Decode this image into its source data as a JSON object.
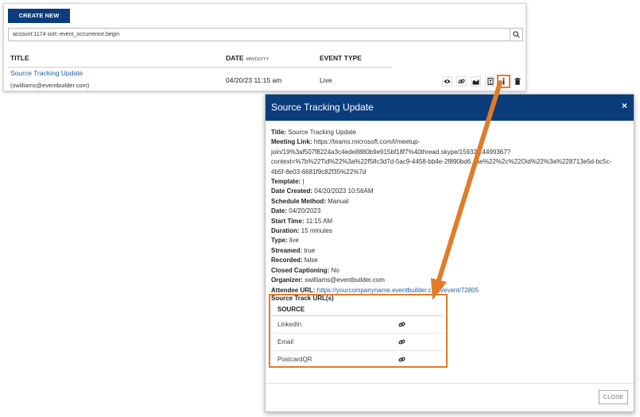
{
  "toolbar": {
    "create_label": "CREATE NEW EVENT"
  },
  "search": {
    "value": "account:1174 sort:-event_occurrence.begin",
    "icon": "search-icon"
  },
  "table": {
    "columns": {
      "title": "TITLE",
      "date": "DATE",
      "date_hint": "MM/DD/YY",
      "type": "EVENT TYPE"
    },
    "rows": [
      {
        "title": "Source Tracking Update",
        "organizer": "(swilliams@eventbuilder.com)",
        "date": "04/20/23 11:15 am",
        "type": "Live",
        "actions": [
          "eye-icon",
          "link-icon",
          "chart-icon",
          "report-icon",
          "info-icon",
          "trash-icon"
        ]
      }
    ]
  },
  "modal": {
    "title": "Source Tracking Update",
    "close_icon": "×",
    "fields": {
      "title_label": "Title:",
      "title": "Source Tracking Update",
      "meeting_link_label": "Meeting Link:",
      "meeting_link_1": "https://teams.microsoft.com/l/meetup-",
      "meeting_link_2": "join/19%3af507f8224a3c4ede8880b9e915bf18f7%40thread.skype/15932...4499367?",
      "meeting_link_3": "context=%7b%22Tid%22%3a%22f58c3d7d-5ac9-4458-bb4e-2f890bd6...ae%22%2c%22Oid%22%3a%228713e5d-bc5c-",
      "meeting_link_4": "4b5f-8e03-6681f9c82f35%22%7d",
      "template_label": "Template:",
      "template": "|",
      "date_created_label": "Date Created:",
      "date_created": "04/20/2023 10:56AM",
      "schedule_label": "Schedule Method:",
      "schedule": "Manual",
      "date_label": "Date:",
      "date": "04/20/2023",
      "start_label": "Start Time:",
      "start": "11:15 AM",
      "duration_label": "Duration:",
      "duration": "15 minutes",
      "type_label": "Type:",
      "type": "live",
      "streamed_label": "Streamed:",
      "streamed": "true",
      "recorded_label": "Recorded:",
      "recorded": "false",
      "captioning_label": "Closed Captioning:",
      "captioning": "No",
      "organizer_label": "Organizer:",
      "organizer": "swilliams@eventbuilder.com",
      "attendee_label": "Attendee URL:",
      "attendee_url": "https://yourcompanyname.eventbuilder.c...m/event/72805"
    },
    "source_label": "Source Track URL(s)",
    "source_header": "SOURCE",
    "sources": [
      "LinkedIn",
      "Email",
      "PostcardQR"
    ],
    "close_label": "CLOSE"
  },
  "colors": {
    "brand": "#0b3d7c",
    "link": "#1f5fa6",
    "highlight": "#e07c2a"
  }
}
